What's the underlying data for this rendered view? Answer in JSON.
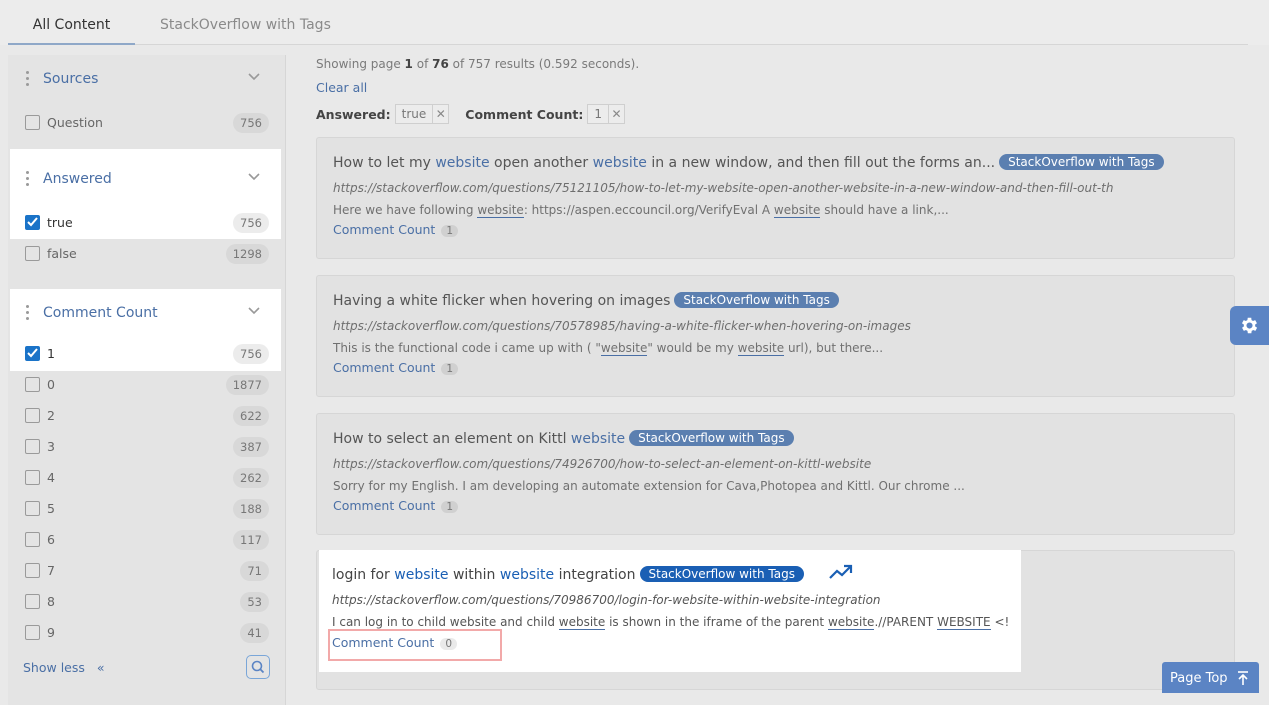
{
  "tabs": [
    "All Content",
    "StackOverflow with Tags"
  ],
  "facets": {
    "sources": {
      "title": "Sources",
      "items": [
        {
          "label": "Question",
          "count": "756",
          "checked": false
        }
      ]
    },
    "answered": {
      "title": "Answered",
      "items": [
        {
          "label": "true",
          "count": "756",
          "checked": true
        },
        {
          "label": "false",
          "count": "1298",
          "checked": false
        }
      ]
    },
    "comment_count": {
      "title": "Comment Count",
      "items": [
        {
          "label": "1",
          "count": "756",
          "checked": true
        },
        {
          "label": "0",
          "count": "1877",
          "checked": false
        },
        {
          "label": "2",
          "count": "622",
          "checked": false
        },
        {
          "label": "3",
          "count": "387",
          "checked": false
        },
        {
          "label": "4",
          "count": "262",
          "checked": false
        },
        {
          "label": "5",
          "count": "188",
          "checked": false
        },
        {
          "label": "6",
          "count": "117",
          "checked": false
        },
        {
          "label": "7",
          "count": "71",
          "checked": false
        },
        {
          "label": "8",
          "count": "53",
          "checked": false
        },
        {
          "label": "9",
          "count": "41",
          "checked": false
        }
      ]
    },
    "show_less": "Show less",
    "show_less_arrow": "«"
  },
  "results": {
    "status": {
      "prefix": "Showing page ",
      "page": "1",
      "of": " of ",
      "total_pages": "76",
      "suffix": " of 757 results (0.592 seconds)."
    },
    "clear_all": "Clear all",
    "active_filters": [
      {
        "label": "Answered:",
        "value": "true"
      },
      {
        "label": "Comment Count:",
        "value": "1"
      }
    ],
    "items": [
      {
        "title_parts": [
          {
            "t": "How to let my ",
            "kw": false
          },
          {
            "t": "website",
            "kw": true
          },
          {
            "t": " open another ",
            "kw": false
          },
          {
            "t": "website",
            "kw": true
          },
          {
            "t": " in a new window, and then fill out the forms an...",
            "kw": false
          }
        ],
        "badge": "StackOverflow with Tags",
        "url": "https://stackoverflow.com/questions/75121105/how-to-let-my-website-open-another-website-in-a-new-window-and-then-fill-out-th",
        "snippet_parts": [
          {
            "t": "Here we have following ",
            "kw": false
          },
          {
            "t": "website",
            "kw": true
          },
          {
            "t": ": https://aspen.eccouncil.org/VerifyEval A ",
            "kw": false
          },
          {
            "t": "website",
            "kw": true
          },
          {
            "t": " should have a link,...",
            "kw": false
          }
        ],
        "cc_label": "Comment Count",
        "cc_value": "1"
      },
      {
        "title_parts": [
          {
            "t": "Having a white flicker when hovering on images",
            "kw": false
          }
        ],
        "badge": "StackOverflow with Tags",
        "url": "https://stackoverflow.com/questions/70578985/having-a-white-flicker-when-hovering-on-images",
        "snippet_parts": [
          {
            "t": "This is the functional code i came up with ( \"",
            "kw": false
          },
          {
            "t": "website",
            "kw": true
          },
          {
            "t": "\" would be my ",
            "kw": false
          },
          {
            "t": "website",
            "kw": true
          },
          {
            "t": " url), but there...",
            "kw": false
          }
        ],
        "cc_label": "Comment Count",
        "cc_value": "1"
      },
      {
        "title_parts": [
          {
            "t": "How to select an element on Kittl ",
            "kw": false
          },
          {
            "t": "website",
            "kw": true
          }
        ],
        "badge": "StackOverflow with Tags",
        "url": "https://stackoverflow.com/questions/74926700/how-to-select-an-element-on-kittl-website",
        "snippet_parts": [
          {
            "t": "Sorry for my English. I am developing an automate extension for Cava,Photopea and Kittl. Our chrome ...",
            "kw": false
          }
        ],
        "cc_label": "Comment Count",
        "cc_value": "1"
      },
      {
        "title_parts": [
          {
            "t": "login for ",
            "kw": false
          },
          {
            "t": "website",
            "kw": true
          },
          {
            "t": " within ",
            "kw": false
          },
          {
            "t": "website",
            "kw": true
          },
          {
            "t": " integration",
            "kw": false
          }
        ],
        "badge": "StackOverflow with Tags",
        "url": "https://stackoverflow.com/questions/70986700/login-for-website-within-website-integration",
        "snippet_parts": [
          {
            "t": "I can log in to child ",
            "kw": false
          },
          {
            "t": "website",
            "kw": true
          },
          {
            "t": " and child ",
            "kw": false
          },
          {
            "t": "website",
            "kw": true
          },
          {
            "t": " is shown in the iframe of the parent ",
            "kw": false
          },
          {
            "t": "website",
            "kw": true
          },
          {
            "t": ".//PARENT ",
            "kw": false
          },
          {
            "t": "WEBSITE",
            "kw": true
          },
          {
            "t": " <!",
            "kw": false
          }
        ],
        "cc_label": "Comment Count",
        "cc_value": "0"
      }
    ]
  },
  "page_top": "Page Top",
  "colors": {
    "accent": "#1a5fb4",
    "link": "#4a6fa5",
    "checkbox": "#1a73c8",
    "button": "#5b84c4",
    "highlight_box": "#f2a9a9"
  },
  "icons": [
    "drag-handle-icon",
    "chevron-down-icon",
    "checkmark-icon",
    "close-icon",
    "search-icon",
    "trending-up-icon",
    "gear-icon",
    "arrow-up-icon"
  ]
}
